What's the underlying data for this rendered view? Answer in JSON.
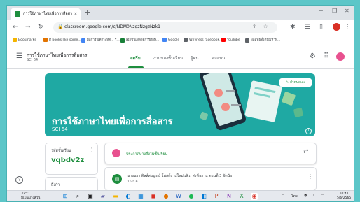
{
  "browser": {
    "tab_title": "การใช้ภาษาไทยเพื่อการสื่อสาร SCI",
    "url": "classroom.google.com/c/NDM0NzgzNzgzNzk1"
  },
  "bookmarks": [
    {
      "label": "Bookmarks",
      "color": "#f4b400"
    },
    {
      "label": "If books like some...",
      "color": "#e37400"
    },
    {
      "label": "ผลการวิเคราะห์ดี... ร...",
      "color": "#4285f4"
    },
    {
      "label": "เอกชนเหลาตการศึกษ...",
      "color": "#188038"
    },
    {
      "label": "Google",
      "color": "#4285f4"
    },
    {
      "label": "Whyness facebook...",
      "color": "#5f6368"
    },
    {
      "label": "YouTube",
      "color": "#ff0000"
    },
    {
      "label": "ผลลัพธ์ที่ได้ปัญหาที่...",
      "color": "#5f6368"
    }
  ],
  "classroom": {
    "title": "การใช้ภาษาไทยเพื่อการสื่อสาร",
    "section": "SCI 64",
    "tabs": [
      "สตรีม",
      "งานของชั้นเรียน",
      "ผู้คน",
      "คะแนน"
    ],
    "banner_title": "การใช้ภาษาไทยเพื่อการสื่อสาร",
    "banner_subtitle": "SCI 64",
    "customize_label": "กำหนดเอง",
    "class_code_label": "รหัสชั้นเรียน",
    "class_code": "vqbdv2z",
    "upcoming_label": "ถึงกำ",
    "announce_placeholder": "ประกาศบางสิ่งในชั้นเรียน",
    "post_title": "นางนรา ดิลล์สมบูรณ์ โพสต์งานใหม่แล้ว: ส่งชิ้นงาน ตอนที่ 3 อัตนัย",
    "post_date": "15 ก.ค."
  },
  "taskbar": {
    "temp": "32°C",
    "weather": "มีเมฆบางส่วน",
    "time": "10:41",
    "date": "5/6/2565",
    "lang": "ไทย"
  },
  "colors": {
    "accent": "#1e8e3e",
    "banner": "#1fa9a3"
  }
}
